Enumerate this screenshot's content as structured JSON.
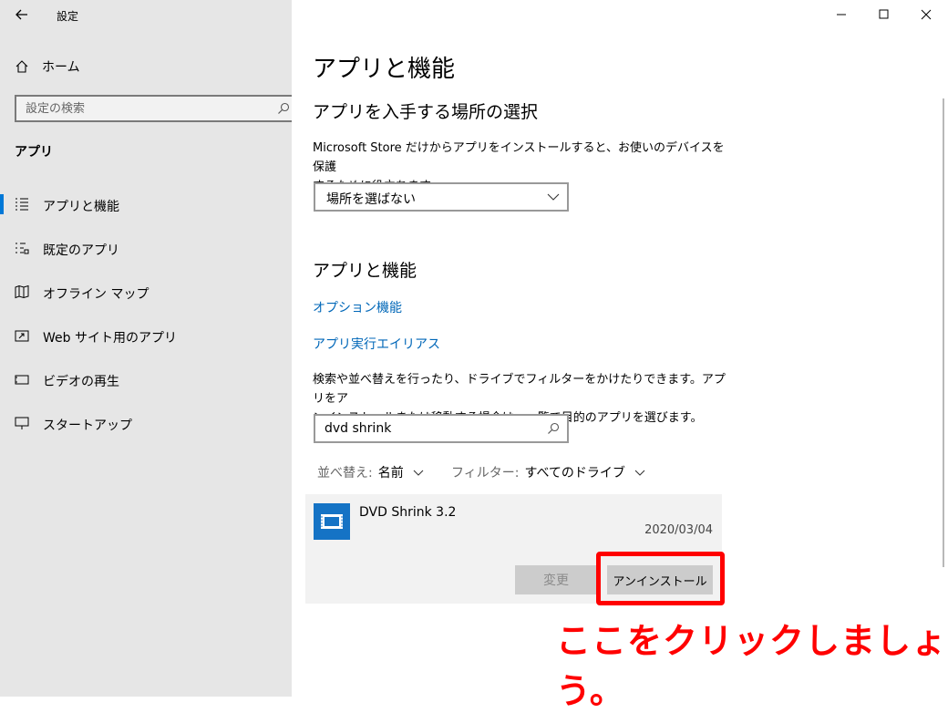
{
  "window": {
    "title": "設定",
    "back_icon": "back-arrow-icon",
    "controls": [
      "minimize-icon",
      "maximize-icon",
      "close-icon"
    ]
  },
  "sidebar": {
    "home_label": "ホーム",
    "search_placeholder": "設定の検索",
    "section_title": "アプリ",
    "items": [
      {
        "label": "アプリと機能",
        "icon": "list-icon",
        "active": true
      },
      {
        "label": "既定のアプリ",
        "icon": "default-apps-icon",
        "active": false
      },
      {
        "label": "オフライン マップ",
        "icon": "map-icon",
        "active": false
      },
      {
        "label": "Web サイト用のアプリ",
        "icon": "web-app-icon",
        "active": false
      },
      {
        "label": "ビデオの再生",
        "icon": "video-icon",
        "active": false
      },
      {
        "label": "スタートアップ",
        "icon": "startup-icon",
        "active": false
      }
    ]
  },
  "main": {
    "page_title": "アプリと機能",
    "install_source": {
      "heading": "アプリを入手する場所の選択",
      "description_line1": "Microsoft Store だけからアプリをインストールすると、お使いのデバイスを保護",
      "description_line2": "するために役立ちます。",
      "dropdown_value": "場所を選ばない"
    },
    "apps": {
      "heading": "アプリと機能",
      "link_optional_features": "オプション機能",
      "link_app_aliases": "アプリ実行エイリアス",
      "description_line1": "検索や並べ替えを行ったり、ドライブでフィルターをかけたりできます。アプリをア",
      "description_line2": "ンインストールまたは移動する場合は、一覧で目的のアプリを選びます。",
      "search_value": "dvd shrink",
      "sort_key": "並べ替え:",
      "sort_value": "名前",
      "filter_key": "フィルター:",
      "filter_value": "すべてのドライブ"
    },
    "app_item": {
      "name": "DVD Shrink 3.2",
      "date": "2020/03/04",
      "change_label": "変更",
      "uninstall_label": "アンインストール"
    }
  },
  "annotation": {
    "text": "ここをクリックしましょう。",
    "color": "#ff0000"
  },
  "colors": {
    "accent": "#0078d7",
    "link": "#0067b8",
    "app_icon": "#1573c5",
    "sidebar_bg": "#e6e6e6"
  }
}
